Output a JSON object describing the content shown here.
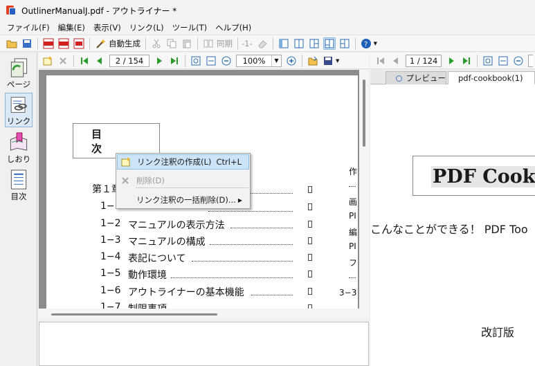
{
  "window": {
    "title": "OutlinerManualJ.pdf - アウトライナー *"
  },
  "menu": [
    "ファイル(F)",
    "編集(E)",
    "表示(V)",
    "リンク(L)",
    "ツール(T)",
    "ヘルプ(H)"
  ],
  "toolbar": {
    "auto_generate": "自動生成",
    "sync": "同期",
    "page_marker": "-1-"
  },
  "sidebar": [
    {
      "label": "ページ",
      "icon": "page-icon"
    },
    {
      "label": "リンク",
      "icon": "link-icon"
    },
    {
      "label": "しおり",
      "icon": "bookmark-icon"
    },
    {
      "label": "目次",
      "icon": "toc-icon"
    }
  ],
  "left_pane": {
    "page_indicator": "2 / 154",
    "zoom": "100%"
  },
  "document": {
    "toc_title": "目　次",
    "chapter": "第１章",
    "entries": [
      {
        "num": "1−1",
        "text": ""
      },
      {
        "num": "1−2",
        "text": "マニュアルの表示方法"
      },
      {
        "num": "1−3",
        "text": "マニュアルの構成"
      },
      {
        "num": "1−4",
        "text": "表記について"
      },
      {
        "num": "1−5",
        "text": "動作環境"
      },
      {
        "num": "1−6",
        "text": "アウトライナーの基本機能"
      },
      {
        "num": "1−7",
        "text": "制限事項"
      }
    ],
    "right_column": [
      "作",
      "画",
      "PI",
      "編",
      "PI",
      "フ",
      "3−3"
    ]
  },
  "context_menu": {
    "items": [
      {
        "label": "リンク注釈の作成(L)",
        "shortcut": "Ctrl+L"
      },
      {
        "label": "削除(D)",
        "shortcut": ""
      },
      {
        "label": "リンク注釈の一括削除(D)...",
        "shortcut": ""
      }
    ]
  },
  "right_pane": {
    "page_indicator": "1 / 124",
    "tabs": [
      "プレビュー",
      "pdf-cookbook(1)"
    ],
    "preview": {
      "title": "PDF CookB",
      "subtitle": "こんなことができる！ PDF Too",
      "edition": "改訂版"
    }
  }
}
